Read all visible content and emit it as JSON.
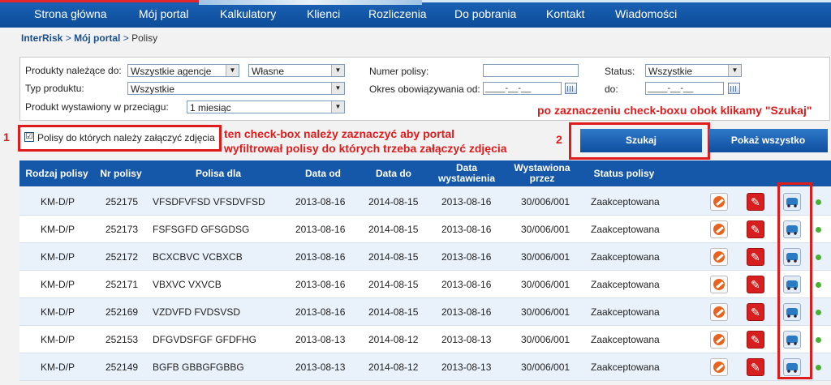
{
  "nav": {
    "items": [
      "Strona główna",
      "Mój portal",
      "Kalkulatory",
      "Klienci",
      "Rozliczenia",
      "Do pobrania",
      "Kontakt",
      "Wiadomości"
    ]
  },
  "breadcrumb": {
    "root": "InterRisk",
    "sep1": ">",
    "portal": "Mój portal",
    "sep2": ">",
    "current": "Polisy"
  },
  "filters": {
    "products_label": "Produkty należące do:",
    "agency_value": "Wszystkie agencje",
    "own_value": "Własne",
    "product_type_label": "Typ produktu:",
    "product_type_value": "Wszystkie",
    "issued_label": "Produkt wystawiony w przeciągu:",
    "issued_value": "1 miesiąc",
    "policy_number_label": "Numer polisy:",
    "policy_number_value": "",
    "validity_label": "Okres obowiązywania od:",
    "date_from_value": "____-__-__",
    "status_label": "Status:",
    "status_value": "Wszystkie",
    "to_label": "do:",
    "date_to_value": "____-__-__"
  },
  "checkbox": {
    "label": "Polisy do których należy załączyć zdjęcia",
    "checked": "☑"
  },
  "buttons": {
    "search": "Szukaj",
    "show_all": "Pokaż wszystko"
  },
  "annotations": {
    "n1": "1",
    "n2": "2",
    "top_right": "po zaznaczeniu check-boxu obok klikamy \"Szukaj\"",
    "mid_line1": "ten check-box należy zaznaczyć aby portal",
    "mid_line2": "wyfiltrował polisy do których trzeba załączyć zdjęcia",
    "color": "#e01b1b"
  },
  "table": {
    "headers": {
      "type": "Rodzaj polisy",
      "number": "Nr polisy",
      "for": "Polisa dla",
      "from": "Data od",
      "to": "Data do",
      "issue_date": "Data wystawienia",
      "issued_by": "Wystawiona przez",
      "status": "Status polisy"
    },
    "rows": [
      {
        "type": "KM-D/P",
        "number": "252175",
        "for": "VFSDFVFSD VFSDVFSD",
        "from": "2013-08-16",
        "to": "2014-08-15",
        "issue_date": "2013-08-16",
        "issued_by": "30/006/001",
        "status": "Zaakceptowana"
      },
      {
        "type": "KM-D/P",
        "number": "252173",
        "for": "FSFSGFD GFSGDSG",
        "from": "2013-08-16",
        "to": "2014-08-15",
        "issue_date": "2013-08-16",
        "issued_by": "30/006/001",
        "status": "Zaakceptowana"
      },
      {
        "type": "KM-D/P",
        "number": "252172",
        "for": "BCXCBVC VCBXCB",
        "from": "2013-08-16",
        "to": "2014-08-15",
        "issue_date": "2013-08-16",
        "issued_by": "30/006/001",
        "status": "Zaakceptowana"
      },
      {
        "type": "KM-D/P",
        "number": "252171",
        "for": "VBXVC VXVCB",
        "from": "2013-08-16",
        "to": "2014-08-15",
        "issue_date": "2013-08-16",
        "issued_by": "30/006/001",
        "status": "Zaakceptowana"
      },
      {
        "type": "KM-D/P",
        "number": "252169",
        "for": "VZDVFD FVDSVSD",
        "from": "2013-08-16",
        "to": "2014-08-15",
        "issue_date": "2013-08-16",
        "issued_by": "30/006/001",
        "status": "Zaakceptowana"
      },
      {
        "type": "KM-D/P",
        "number": "252153",
        "for": "DFGVDSFGF GFDFHG",
        "from": "2013-08-13",
        "to": "2014-08-12",
        "issue_date": "2013-08-13",
        "issued_by": "30/006/001",
        "status": "Zaakceptowana"
      },
      {
        "type": "KM-D/P",
        "number": "252149",
        "for": "BGFB GBBGFGBBG",
        "from": "2013-08-13",
        "to": "2014-08-12",
        "issue_date": "2013-08-13",
        "issued_by": "30/006/001",
        "status": "Zaakceptowana"
      }
    ]
  },
  "colors": {
    "nav": "#1557a8",
    "header": "#1557a8",
    "status_ok": "#48b230"
  },
  "icons": {
    "cancel": "cancel-icon",
    "pdf": "pdf-icon",
    "photo": "car-photo-icon",
    "status": "status-dot-icon"
  }
}
